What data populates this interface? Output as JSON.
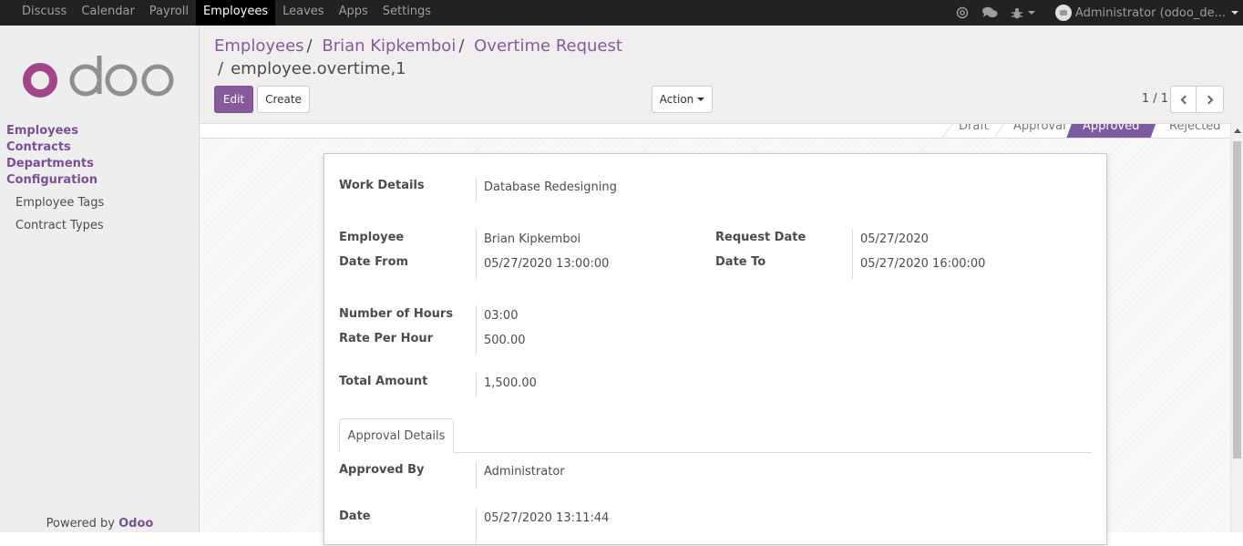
{
  "topnav": {
    "items": [
      "Discuss",
      "Calendar",
      "Payroll",
      "Employees",
      "Leaves",
      "Apps",
      "Settings"
    ],
    "active": "Employees",
    "user": "Administrator (odoo_de..."
  },
  "sidebar": {
    "logo": "odoo",
    "menu": [
      "Employees",
      "Contracts",
      "Departments",
      "Configuration"
    ],
    "submenu": [
      "Employee Tags",
      "Contract Types"
    ],
    "powered_by": "Powered by",
    "powered_brand": "Odoo"
  },
  "breadcrumb": {
    "items": [
      "Employees",
      "Brian Kipkemboi",
      "Overtime Request"
    ],
    "current": "employee.overtime,1",
    "sep": "/"
  },
  "buttons": {
    "edit": "Edit",
    "create": "Create",
    "action": "Action"
  },
  "pager": {
    "value": "1 / 1"
  },
  "stages": {
    "items": [
      "Draft",
      "Approval",
      "Approved",
      "Rejected"
    ],
    "current": "Approved"
  },
  "form": {
    "work_details_label": "Work Details",
    "work_details": "Database Redesigning",
    "employee_label": "Employee",
    "employee": "Brian Kipkemboi",
    "request_date_label": "Request Date",
    "request_date": "05/27/2020",
    "date_from_label": "Date From",
    "date_from": "05/27/2020 13:00:00",
    "date_to_label": "Date To",
    "date_to": "05/27/2020 16:00:00",
    "hours_label": "Number of Hours",
    "hours": "03:00",
    "rate_label": "Rate Per Hour",
    "rate": "500.00",
    "total_label": "Total Amount",
    "total": "1,500.00",
    "tab_label": "Approval Details",
    "approved_by_label": "Approved By",
    "approved_by": "Administrator",
    "date_label": "Date",
    "date": "05/27/2020 13:11:44"
  },
  "colors": {
    "brand": "#875a9b",
    "topbar": "#222222"
  }
}
